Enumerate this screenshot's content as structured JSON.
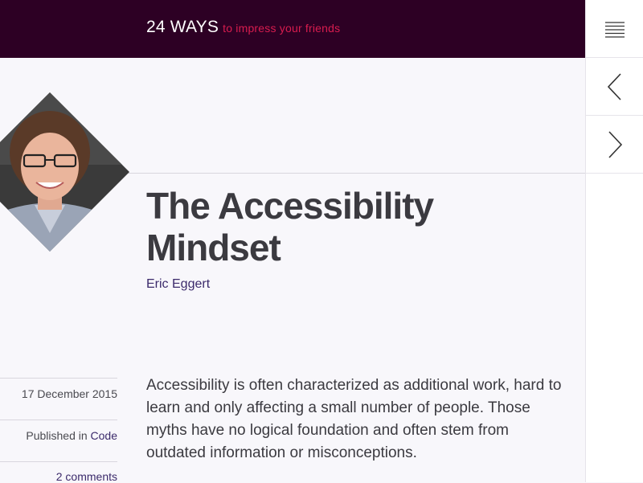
{
  "header": {
    "brand": "24 WAYS",
    "tagline": "to impress your friends"
  },
  "sidebar": {
    "menu_icon": "hamburger-menu-icon",
    "prev_icon": "chevron-left-icon",
    "next_icon": "chevron-right-icon"
  },
  "article": {
    "title": "The Accessibility Mindset",
    "author": "Eric Eggert",
    "date": "17 December 2015",
    "published_prefix": "Published in",
    "category": "Code",
    "comments": "2 comments",
    "intro": "Accessibility is often characterized as additional work, hard to learn and only affecting a small number of people. Those myths have no logical foundation and often stem from outdated information or misconceptions."
  },
  "colors": {
    "header_bg": "#2d0024",
    "tagline": "#d81c4f",
    "link": "#3b2a6b",
    "page_bg": "#f8f7fb"
  }
}
